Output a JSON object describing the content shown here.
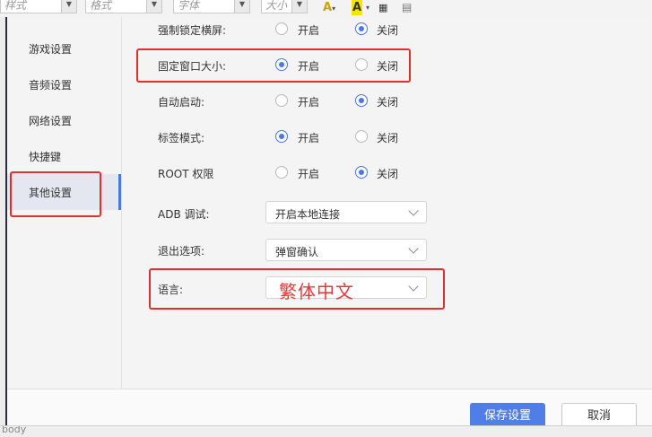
{
  "toolbar": {
    "style_combo": "样式",
    "format_combo": "格式",
    "font_combo": "字体",
    "size_combo": "大小"
  },
  "sidebar": {
    "items": [
      {
        "label": "游戏设置"
      },
      {
        "label": "音频设置"
      },
      {
        "label": "网络设置"
      },
      {
        "label": "快捷键"
      },
      {
        "label": "其他设置",
        "active": true
      }
    ]
  },
  "settings": {
    "force_landscape": {
      "label": "强制锁定横屏:",
      "on": "开启",
      "off": "关闭",
      "selected": "关闭"
    },
    "fixed_window": {
      "label": "固定窗口大小:",
      "on": "开启",
      "off": "关闭",
      "selected": "开启"
    },
    "autostart": {
      "label": "自动启动:",
      "on": "开启",
      "off": "关闭",
      "selected": "关闭"
    },
    "tab_mode": {
      "label": "标签模式:",
      "on": "开启",
      "off": "关闭",
      "selected": "开启"
    },
    "root": {
      "label": "ROOT 权限",
      "on": "开启",
      "off": "关闭",
      "selected": "关闭"
    },
    "adb": {
      "label": "ADB 调试:",
      "value": "开启本地连接"
    },
    "exit": {
      "label": "退出选项:",
      "value": "弹窗确认"
    },
    "language": {
      "label": "语言:",
      "value": "繁体中文"
    }
  },
  "footer": {
    "save_label": "保存设置",
    "cancel_label": "取消"
  },
  "statusbar": {
    "text": "body"
  },
  "colors": {
    "accent": "#4f7ee6",
    "highlight": "#e0302b"
  }
}
